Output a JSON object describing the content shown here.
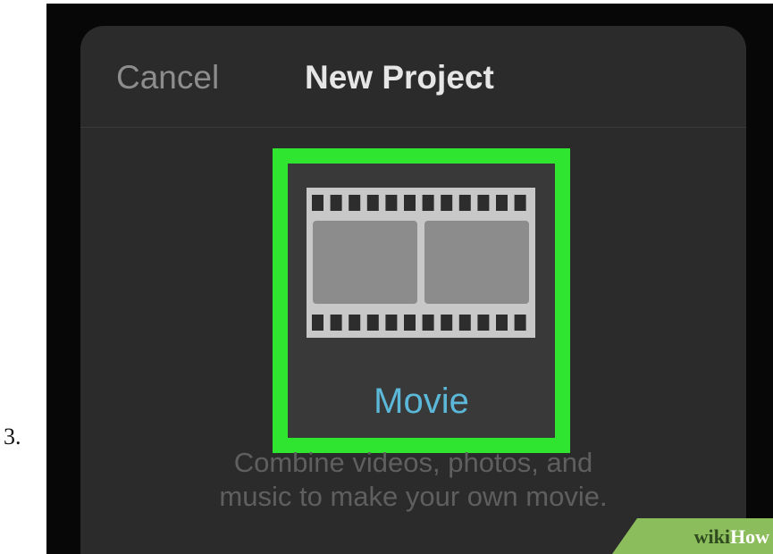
{
  "step": {
    "number": "3."
  },
  "header": {
    "cancel_label": "Cancel",
    "title": "New Project"
  },
  "project_option": {
    "label": "Movie",
    "icon": "film-strip-icon",
    "highlight_color": "#2fe52f",
    "label_color": "#5bb8d8"
  },
  "description": {
    "line1": "Combine videos, photos, and",
    "line2": "music to make your own movie."
  },
  "watermark": {
    "wiki": "wiki",
    "how": "How",
    "color": "#8cbd5c"
  }
}
